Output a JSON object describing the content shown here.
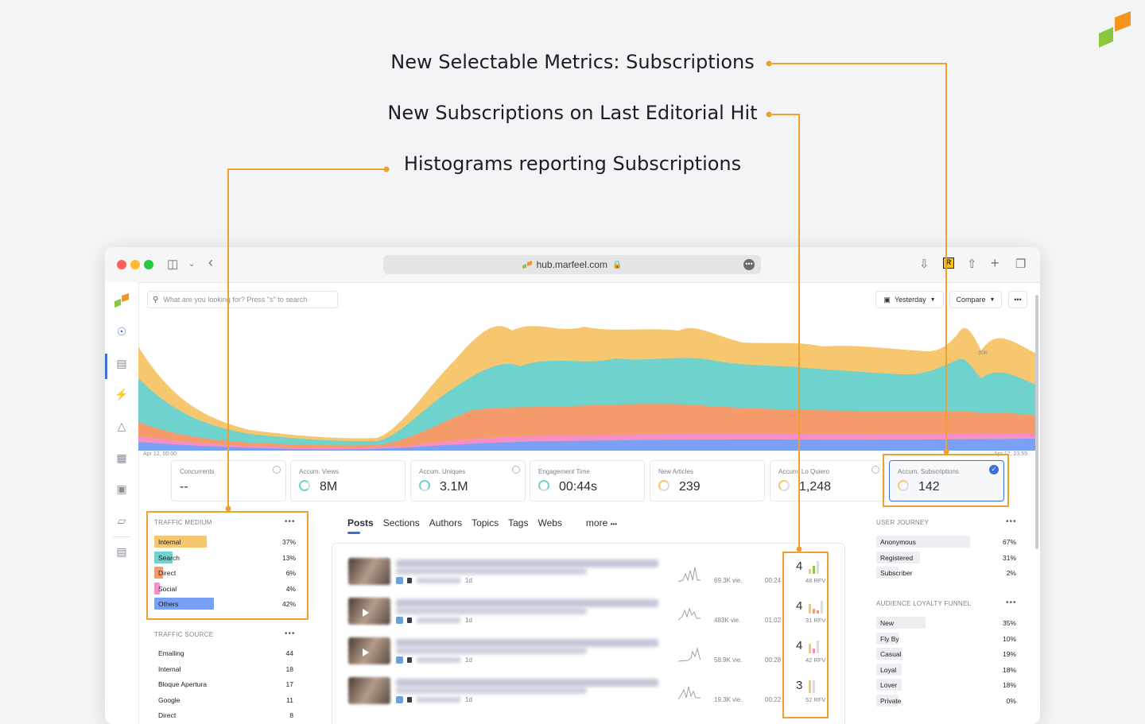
{
  "callouts": {
    "selectable_metrics": "New Selectable Metrics: Subscriptions",
    "subscriptions_last_hit": "New Subscriptions on Last Editorial Hit",
    "histograms": "Histograms reporting Subscriptions"
  },
  "colors": {
    "accent_orange": "#f0a030",
    "brand_green": "#8cc63f",
    "brand_orange": "#f7941d",
    "series_yellow": "#f6c76e",
    "series_teal": "#6fd2cc",
    "series_orange": "#f59b6b",
    "series_pink": "#f58fc5",
    "series_blue": "#7aa0f5",
    "active_blue": "#3f6fd8"
  },
  "browser": {
    "url": "hub.marfeel.com",
    "lock_icon": "lock-icon"
  },
  "toolbar": {
    "search_placeholder": "What are you looking for? Press \"s\" to search",
    "date_label": "Yesterday",
    "compare_label": "Compare",
    "more_label": "•••"
  },
  "chart": {
    "start_label": "Apr 12, 00:00",
    "end_label": "Apr 12, 23:59",
    "y_tick": "30K"
  },
  "kpis": [
    {
      "label": "Concurrents",
      "value": "--"
    },
    {
      "label": "Accum. Views",
      "value": "8M"
    },
    {
      "label": "Accum. Uniques",
      "value": "3.1M"
    },
    {
      "label": "Engagement Time",
      "value": "00:44s"
    },
    {
      "label": "New Articles",
      "value": "239"
    },
    {
      "label": "Accum. Lo Quiero",
      "value": "1,248"
    },
    {
      "label": "Accum. Subscriptions",
      "value": "142"
    }
  ],
  "traffic_medium": {
    "title": "TRAFFIC MEDIUM",
    "rows": [
      {
        "name": "Internal",
        "pct": "37%",
        "share": 0.37,
        "color": "#f6c76e"
      },
      {
        "name": "Search",
        "pct": "13%",
        "share": 0.13,
        "color": "#6fd2cc"
      },
      {
        "name": "Direct",
        "pct": "6%",
        "share": 0.06,
        "color": "#f59b6b"
      },
      {
        "name": "Social",
        "pct": "4%",
        "share": 0.04,
        "color": "#f58fc5"
      },
      {
        "name": "Others",
        "pct": "42%",
        "share": 0.42,
        "color": "#7aa0f5"
      }
    ]
  },
  "traffic_source": {
    "title": "TRAFFIC SOURCE",
    "rows": [
      {
        "name": "Emailing",
        "value": "44"
      },
      {
        "name": "Internal",
        "value": "18"
      },
      {
        "name": "Bloque Apertura",
        "value": "17"
      },
      {
        "name": "Google",
        "value": "11"
      },
      {
        "name": "Direct",
        "value": "8"
      }
    ]
  },
  "tabs": [
    "Posts",
    "Sections",
    "Authors",
    "Topics",
    "Tags",
    "Webs"
  ],
  "tabs_more": "more",
  "posts": [
    {
      "age": "1d",
      "views": "69.3K vie.",
      "time": "00:24",
      "subs": "4",
      "rfv": "48 RFV"
    },
    {
      "age": "1d",
      "views": "483K vie.",
      "time": "01:02",
      "subs": "4",
      "rfv": "31 RFV"
    },
    {
      "age": "1d",
      "views": "58.9K vie.",
      "time": "00:28",
      "subs": "4",
      "rfv": "42 RFV"
    },
    {
      "age": "1d",
      "views": "19.3K vie.",
      "time": "00:22",
      "subs": "3",
      "rfv": "52 RFV"
    }
  ],
  "user_journey": {
    "title": "USER JOURNEY",
    "rows": [
      {
        "name": "Anonymous",
        "pct": "67%",
        "share": 0.67
      },
      {
        "name": "Registered",
        "pct": "31%",
        "share": 0.31
      },
      {
        "name": "Subscriber",
        "pct": "2%",
        "share": 0.02
      }
    ]
  },
  "loyalty_funnel": {
    "title": "AUDIENCE LOYALTY FUNNEL",
    "rows": [
      {
        "name": "New",
        "pct": "35%",
        "share": 0.35
      },
      {
        "name": "Fly By",
        "pct": "10%",
        "share": 0.1
      },
      {
        "name": "Casual",
        "pct": "19%",
        "share": 0.19
      },
      {
        "name": "Loyal",
        "pct": "18%",
        "share": 0.18
      },
      {
        "name": "Lover",
        "pct": "18%",
        "share": 0.18
      },
      {
        "name": "Private",
        "pct": "0%",
        "share": 0.0
      }
    ]
  }
}
